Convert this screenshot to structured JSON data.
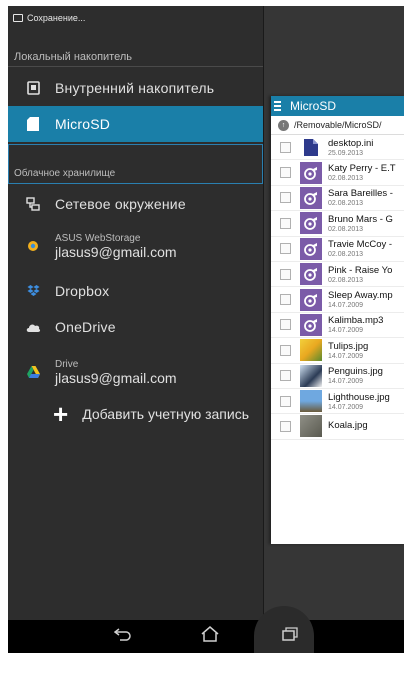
{
  "status_bar": {
    "text": "Сохранение..."
  },
  "drawer": {
    "local_section": "Локальный накопитель",
    "internal": "Внутренний накопитель",
    "microsd": "MicroSD",
    "cloud_section": "Облачное хранилище",
    "network": "Сетевое окружение",
    "webstorage": {
      "service": "ASUS WebStorage",
      "account": "jlasus9@gmail.com"
    },
    "dropbox": "Dropbox",
    "onedrive": "OneDrive",
    "drive": {
      "service": "Drive",
      "account": "jlasus9@gmail.com"
    },
    "add_account": "Добавить учетную запись"
  },
  "file_panel": {
    "title": "MicroSD",
    "path": "/Removable/MicroSD/",
    "files": [
      {
        "name": "desktop.ini",
        "date": "25.09.2013",
        "type": "doc"
      },
      {
        "name": "Katy Perry - E.T",
        "date": "02.08.2013",
        "type": "music"
      },
      {
        "name": "Sara Bareilles - ",
        "date": "02.08.2013",
        "type": "music"
      },
      {
        "name": "Bruno Mars - G",
        "date": "02.08.2013",
        "type": "music"
      },
      {
        "name": "Travie McCoy - ",
        "date": "02.08.2013",
        "type": "music"
      },
      {
        "name": "Pink - Raise Yo",
        "date": "02.08.2013",
        "type": "music"
      },
      {
        "name": "Sleep Away.mp",
        "date": "14.07.2009",
        "type": "music"
      },
      {
        "name": "Kalimba.mp3",
        "date": "14.07.2009",
        "type": "music"
      },
      {
        "name": "Tulips.jpg",
        "date": "14.07.2009",
        "type": "img-tulips"
      },
      {
        "name": "Penguins.jpg",
        "date": "14.07.2009",
        "type": "img-penguins"
      },
      {
        "name": "Lighthouse.jpg",
        "date": "14.07.2009",
        "type": "img-lighthouse"
      },
      {
        "name": "Koala.jpg",
        "date": "",
        "type": "img-koala"
      }
    ]
  },
  "icons": {
    "back": "back-icon",
    "home": "home-icon",
    "recents": "recents-icon"
  },
  "colors": {
    "accent": "#1a7fa8",
    "drawer_bg": "#2d2d2d",
    "music_thumb": "#7b5ba8"
  }
}
